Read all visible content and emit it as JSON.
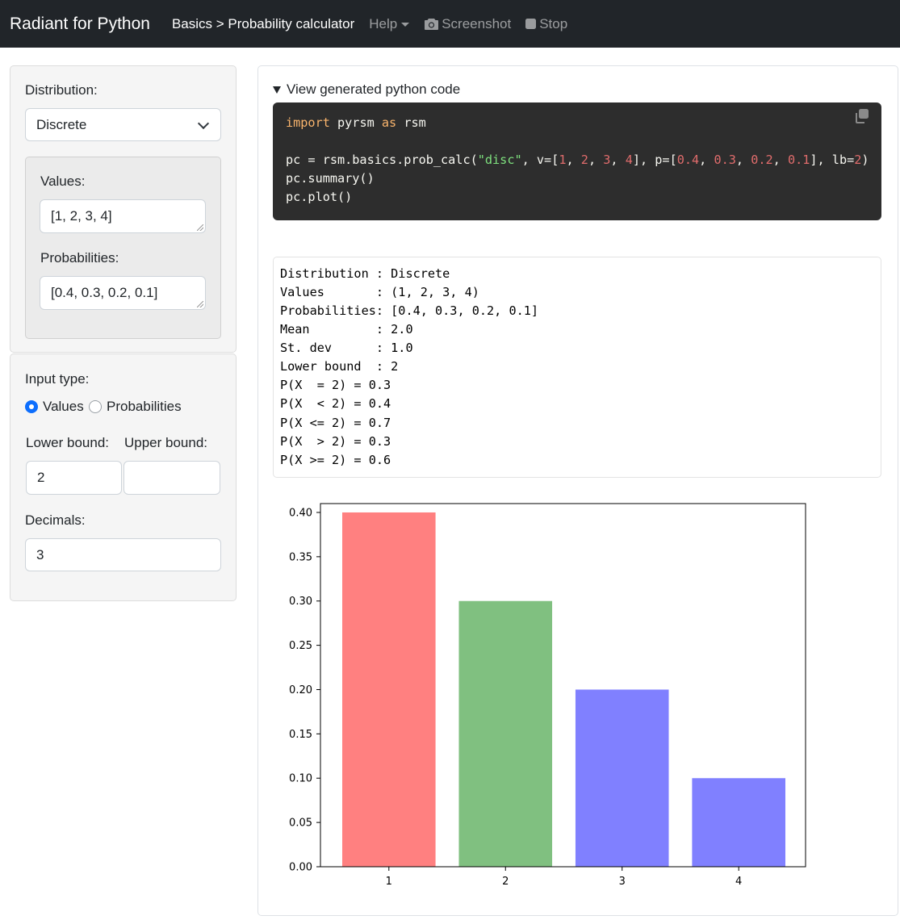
{
  "navbar": {
    "brand": "Radiant for Python",
    "breadcrumb": "Basics > Probability calculator",
    "help": "Help",
    "screenshot": "Screenshot",
    "stop": "Stop"
  },
  "sidebar": {
    "distribution_label": "Distribution:",
    "distribution_value": "Discrete",
    "values_label": "Values:",
    "values_value": "[1, 2, 3, 4]",
    "probabilities_label": "Probabilities:",
    "probabilities_value": "[0.4, 0.3, 0.2, 0.1]",
    "input_type_label": "Input type:",
    "input_type_options": [
      "Values",
      "Probabilities"
    ],
    "input_type_selected": "Values",
    "lower_bound_label": "Lower bound:",
    "upper_bound_label": "Upper bound:",
    "lower_bound_value": "2",
    "upper_bound_value": "",
    "decimals_label": "Decimals:",
    "decimals_value": "3"
  },
  "main": {
    "code_toggle_label": "View generated python code",
    "code": {
      "line1": {
        "kw1": "import",
        "mid": " pyrsm ",
        "kw2": "as",
        "end": " rsm"
      },
      "line2": {
        "a": "pc = rsm.basics.prob_calc(",
        "s": "\"disc\"",
        "b": ", v=[",
        "v1": "1",
        "c1": ", ",
        "v2": "2",
        "c2": ", ",
        "v3": "3",
        "c3": ", ",
        "v4": "4",
        "d": "], p=[",
        "p1": "0.4",
        "e1": ", ",
        "p2": "0.3",
        "e2": ", ",
        "p3": "0.2",
        "e3": ", ",
        "p4": "0.1",
        "f": "], lb=",
        "lb": "2",
        "g": ")"
      },
      "line3": "pc.summary()",
      "line4": "pc.plot()"
    },
    "summary_lines": [
      "Distribution : Discrete",
      "Values       : (1, 2, 3, 4)",
      "Probabilities: [0.4, 0.3, 0.2, 0.1]",
      "Mean         : 2.0",
      "St. dev      : 1.0",
      "Lower bound  : 2",
      "P(X  = 2) = 0.3",
      "P(X  < 2) = 0.4",
      "P(X <= 2) = 0.7",
      "P(X  > 2) = 0.3",
      "P(X >= 2) = 0.6"
    ]
  },
  "chart_data": {
    "type": "bar",
    "categories": [
      "1",
      "2",
      "3",
      "4"
    ],
    "values": [
      0.4,
      0.3,
      0.2,
      0.1
    ],
    "colors": [
      "#ff8080",
      "#80c080",
      "#8080ff",
      "#8080ff"
    ],
    "ylim": [
      0,
      0.41
    ],
    "yticks": [
      "0.00",
      "0.05",
      "0.10",
      "0.15",
      "0.20",
      "0.25",
      "0.30",
      "0.35",
      "0.40"
    ],
    "title": "",
    "xlabel": "",
    "ylabel": ""
  },
  "colors": {
    "navbar_bg": "#212529",
    "accent": "#0d6efd",
    "code_bg": "#2d2d2d"
  }
}
